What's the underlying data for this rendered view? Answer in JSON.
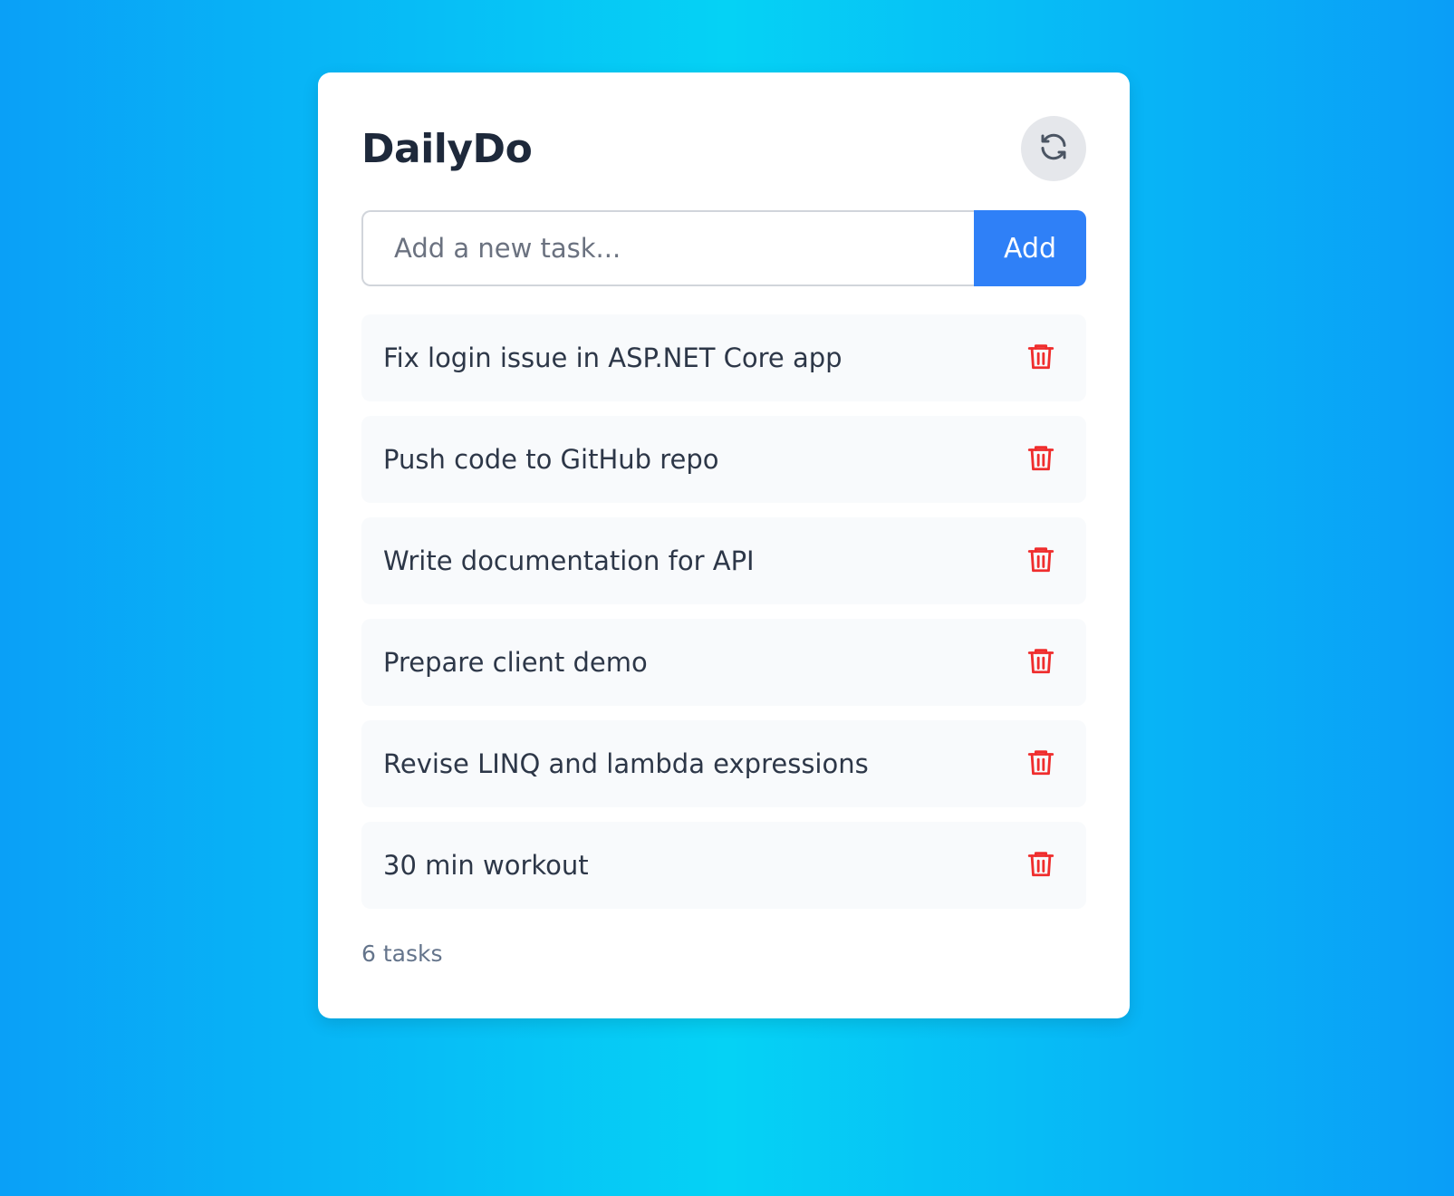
{
  "app": {
    "title": "DailyDo"
  },
  "add_form": {
    "placeholder": "Add a new task...",
    "value": "",
    "add_label": "Add"
  },
  "tasks": [
    {
      "text": "Fix login issue in ASP.NET Core app"
    },
    {
      "text": "Push code to GitHub repo"
    },
    {
      "text": "Write documentation for API"
    },
    {
      "text": "Prepare client demo"
    },
    {
      "text": "Revise LINQ and lambda expressions"
    },
    {
      "text": "30 min workout"
    }
  ],
  "footer": {
    "count_text": "6 tasks"
  },
  "icons": {
    "refresh": "refresh-icon",
    "delete": "trash-icon"
  },
  "colors": {
    "accent": "#2f80f7",
    "delete": "#ef2d2d",
    "title": "#1e293b"
  }
}
